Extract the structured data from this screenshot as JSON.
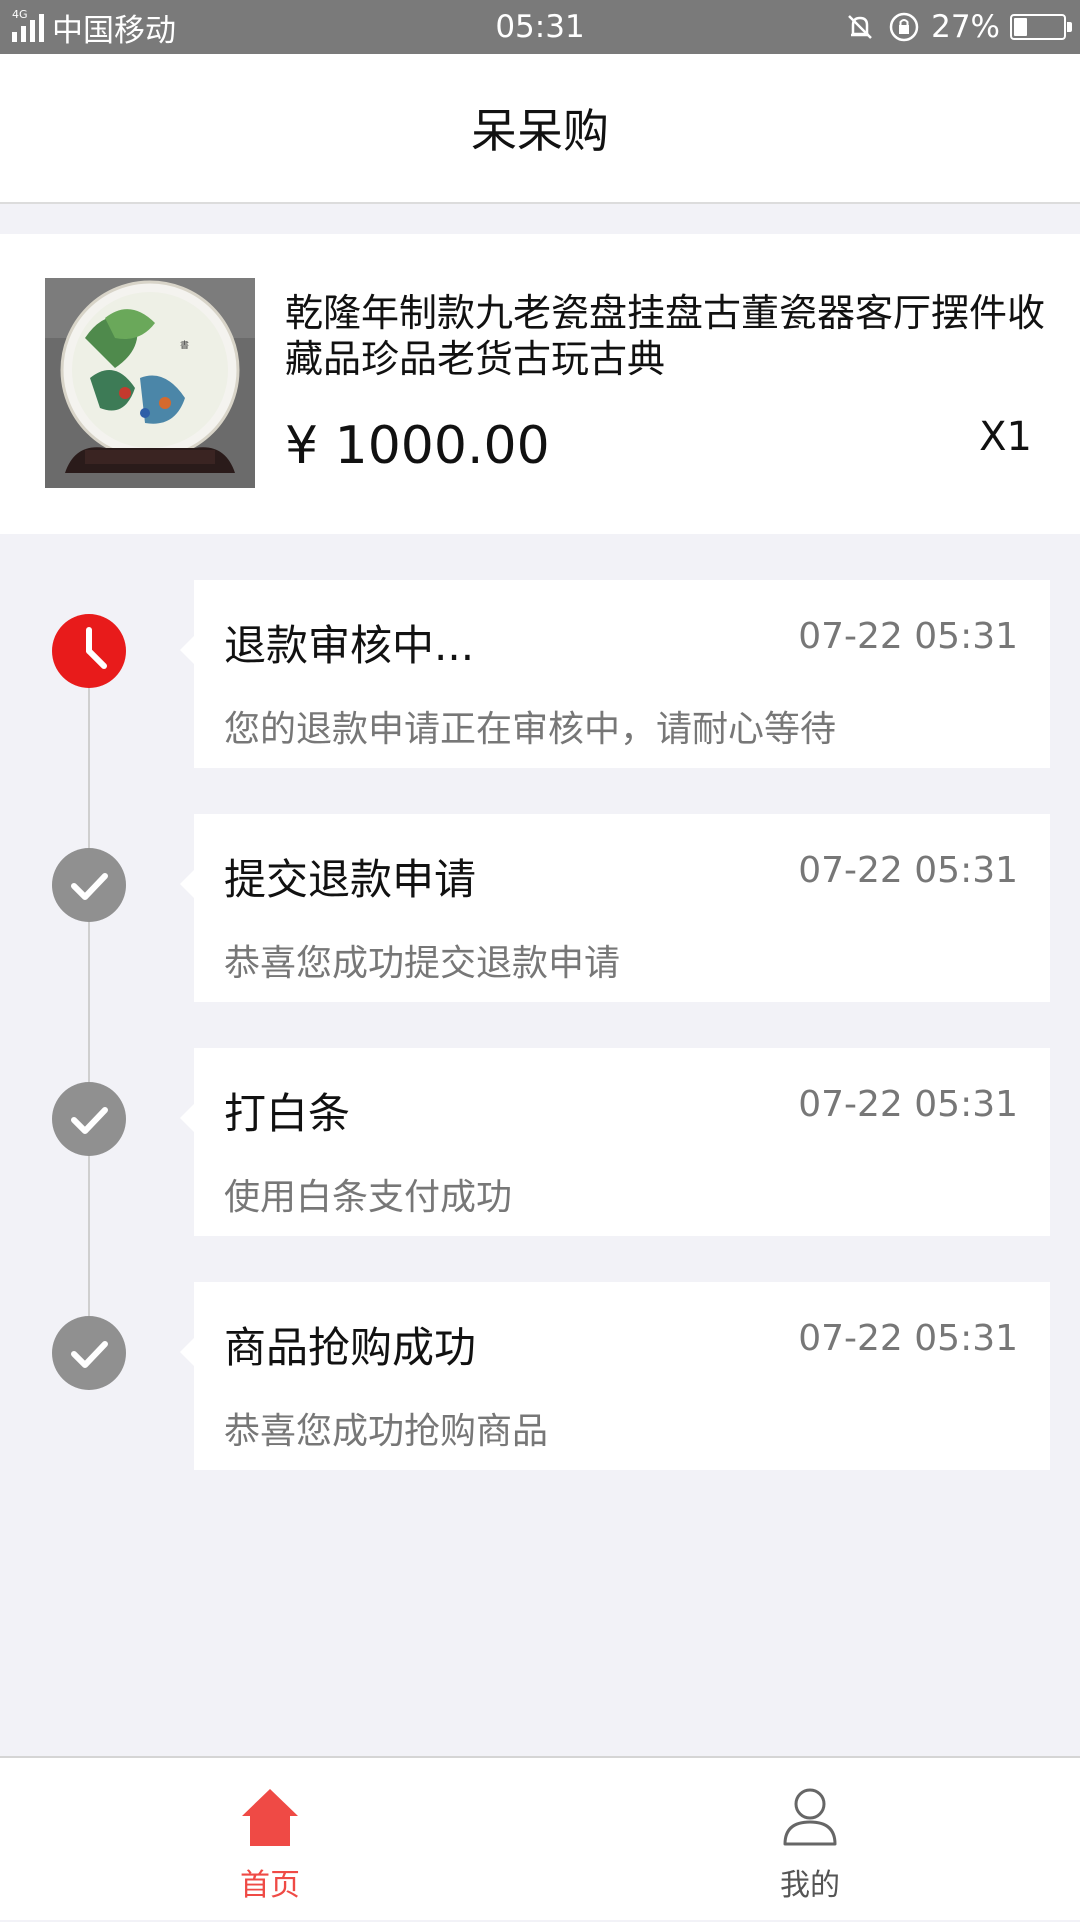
{
  "status_bar": {
    "network_type": "4G",
    "carrier": "中国移动",
    "time": "05:31",
    "battery_percent": "27%",
    "battery_level": 0.27
  },
  "header": {
    "title": "呆呆购"
  },
  "product": {
    "title": "乾隆年制款九老瓷盘挂盘古董瓷器客厅摆件收藏品珍品老货古玩古典",
    "price": "¥ 1000.00",
    "quantity": "X1"
  },
  "timeline": [
    {
      "title": "退款审核中...",
      "time": "07-22 05:31",
      "desc": "您的退款申请正在审核中，请耐心等待",
      "icon": "clock-icon",
      "state": "active"
    },
    {
      "title": "提交退款申请",
      "time": "07-22 05:31",
      "desc": "恭喜您成功提交退款申请",
      "icon": "check-icon",
      "state": "done"
    },
    {
      "title": "打白条",
      "time": "07-22 05:31",
      "desc": "使用白条支付成功",
      "icon": "check-icon",
      "state": "done"
    },
    {
      "title": "商品抢购成功",
      "time": "07-22 05:31",
      "desc": "恭喜您成功抢购商品",
      "icon": "check-icon",
      "state": "done"
    }
  ],
  "bottom_nav": {
    "home": {
      "label": "首页",
      "icon": "home-icon",
      "active": true
    },
    "mine": {
      "label": "我的",
      "icon": "user-icon",
      "active": false
    }
  },
  "colors": {
    "accent_red": "#e81b1b",
    "nav_active": "#ef4a45",
    "done_gray": "#909090",
    "background": "#f2f2f7"
  }
}
